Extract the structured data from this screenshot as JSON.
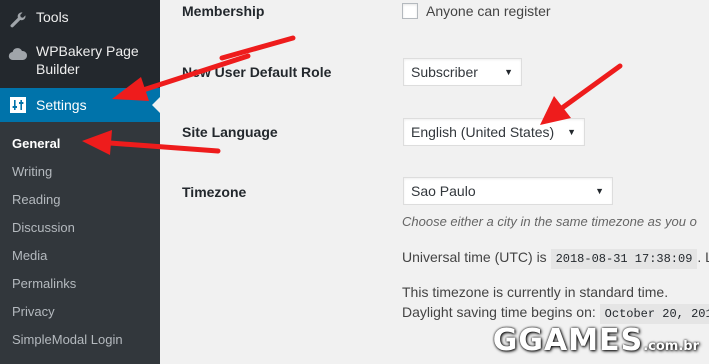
{
  "sidebar": {
    "tools_label": "Tools",
    "wpbakery_line1": "WPBakery Page",
    "wpbakery_line2": "Builder",
    "settings_label": "Settings",
    "submenu": [
      "General",
      "Writing",
      "Reading",
      "Discussion",
      "Media",
      "Permalinks",
      "Privacy",
      "SimpleModal Login"
    ],
    "current": "General",
    "icons": {
      "tools": "wrench-icon",
      "wpbakery": "cloud-icon",
      "settings": "sliders-icon"
    }
  },
  "settings": {
    "membership_label": "Membership",
    "membership_checkbox_label": "Anyone can register",
    "membership_checked": false,
    "default_role_label": "New User Default Role",
    "default_role_value": "Subscriber",
    "site_language_label": "Site Language",
    "site_language_value": "English (United States)",
    "timezone_label": "Timezone",
    "timezone_value": "Sao Paulo",
    "timezone_desc": "Choose either a city in the same timezone as you o",
    "utc_prefix": "Universal time (UTC) is",
    "utc_value": "2018-08-31 17:38:09",
    "utc_suffix": ". Lo",
    "standard_time_text": "This timezone is currently in standard time.",
    "dst_prefix": "Daylight saving time begins on:",
    "dst_value": "October 20, 201"
  },
  "watermark": {
    "brand": "GGAMES",
    "suffix": ".com.br"
  },
  "colors": {
    "sidebar_bg": "#23282d",
    "submenu_bg": "#32373c",
    "active_bg": "#0073aa",
    "arrow": "#ee1c1c"
  }
}
